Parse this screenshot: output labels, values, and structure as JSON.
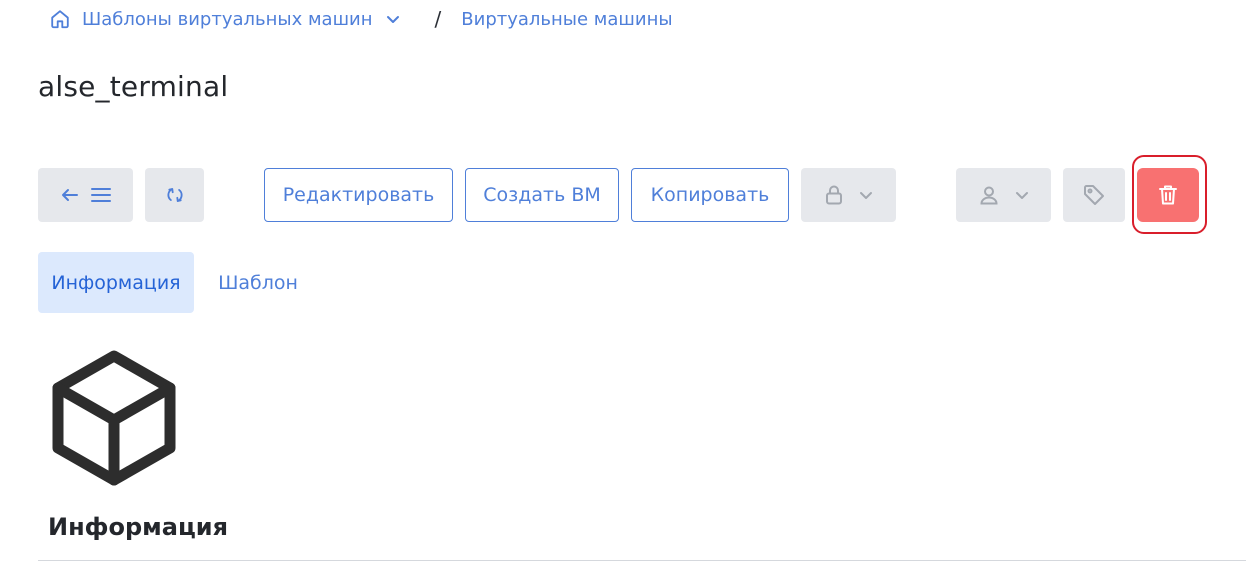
{
  "breadcrumb": {
    "home_icon": "home-icon",
    "parent_label": "Шаблоны виртуальных машин",
    "chevron_icon": "chevron-down-icon",
    "separator": "/",
    "current_label": "Виртуальные машины"
  },
  "page": {
    "title": "alse_terminal"
  },
  "toolbar": {
    "back_menu_icons": [
      "arrow-left-icon",
      "menu-icon"
    ],
    "refresh_icon": "refresh-icon",
    "edit_label": "Редактировать",
    "create_vm_label": "Создать ВМ",
    "copy_label": "Копировать",
    "lock_icon": "lock-icon",
    "owner_icon": "user-icon",
    "tag_icon": "tag-icon",
    "delete_icon": "trash-icon"
  },
  "tabs": [
    {
      "label": "Информация",
      "active": true
    },
    {
      "label": "Шаблон",
      "active": false
    }
  ],
  "content": {
    "section_icon": "cube-icon",
    "section_title": "Информация"
  },
  "colors": {
    "accent": "#4f7fd9",
    "tab_active_bg": "#dce9fd",
    "danger": "#f87171",
    "danger_ring": "#d91e2b",
    "neutral_button": "#e6e8ec"
  }
}
